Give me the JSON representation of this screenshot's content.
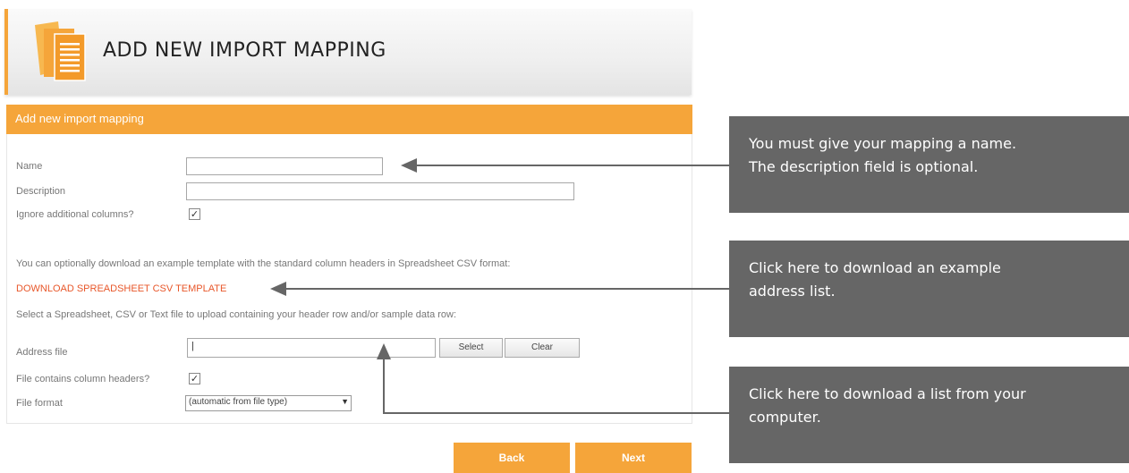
{
  "header": {
    "title": "ADD NEW IMPORT MAPPING"
  },
  "panel": {
    "title": "Add new import mapping"
  },
  "form": {
    "name_label": "Name",
    "name_value": "",
    "description_label": "Description",
    "description_value": "",
    "ignore_label": "Ignore additional columns?",
    "ignore_checked": "✓",
    "template_text": "You can optionally download an example template with the standard column headers in Spreadsheet CSV format:",
    "download_link": "DOWNLOAD SPREADSHEET CSV TEMPLATE",
    "upload_text": "Select a Spreadsheet, CSV or Text file to upload containing your header row and/or sample data row:",
    "address_label": "Address file",
    "address_value": "|",
    "select_button": "Select",
    "clear_button": "Clear",
    "headers_label": "File contains column headers?",
    "headers_checked": "✓",
    "format_label": "File format",
    "format_value": "(automatic from file type)"
  },
  "nav": {
    "back": "Back",
    "next": "Next"
  },
  "callouts": {
    "name": [
      "You must give your mapping a name.",
      "The description field is optional."
    ],
    "download": [
      "Click here to download an example",
      "address list."
    ],
    "upload": [
      "Click here to download a list from your",
      "computer."
    ]
  },
  "colors": {
    "accent": "#f5a53a",
    "callout_bg": "#666666",
    "link": "#e8572a"
  }
}
